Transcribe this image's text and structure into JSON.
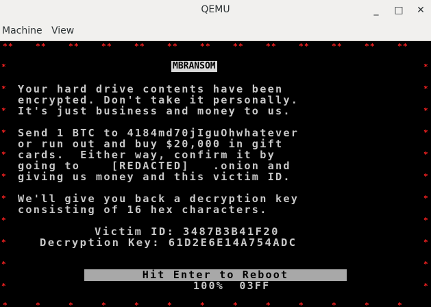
{
  "window": {
    "title": "QEMU",
    "minimize_glyph": "_",
    "maximize_glyph": "□",
    "close_glyph": "✕"
  },
  "menubar": {
    "items": [
      "Machine",
      "View"
    ]
  },
  "screen": {
    "accent_color": "#ff2222",
    "border_glyph": "*",
    "banner": "MBRANSOM",
    "paragraph1": [
      "Your hard drive contents have been",
      "encrypted. Don't take it personally.",
      "It's just business and money to us."
    ],
    "paragraph2": [
      "Send 1 BTC to 4184md70jIguOhwhatever",
      "or run out and buy $20,000 in gift",
      "cards.  Either way, confirm it by",
      "going to    [REDACTED]   .onion and",
      "giving us money and this victim ID."
    ],
    "paragraph3": [
      "We'll give you back a decryption key",
      "consisting of 16 hex characters."
    ],
    "victim_id_line": "Victim ID: 3487B3B41F20",
    "decryption_key_line": "Decryption Key: 61D2E6E14A754ADC",
    "reboot_label": "Hit Enter to Reboot",
    "progress_text": "100%  03FF"
  }
}
